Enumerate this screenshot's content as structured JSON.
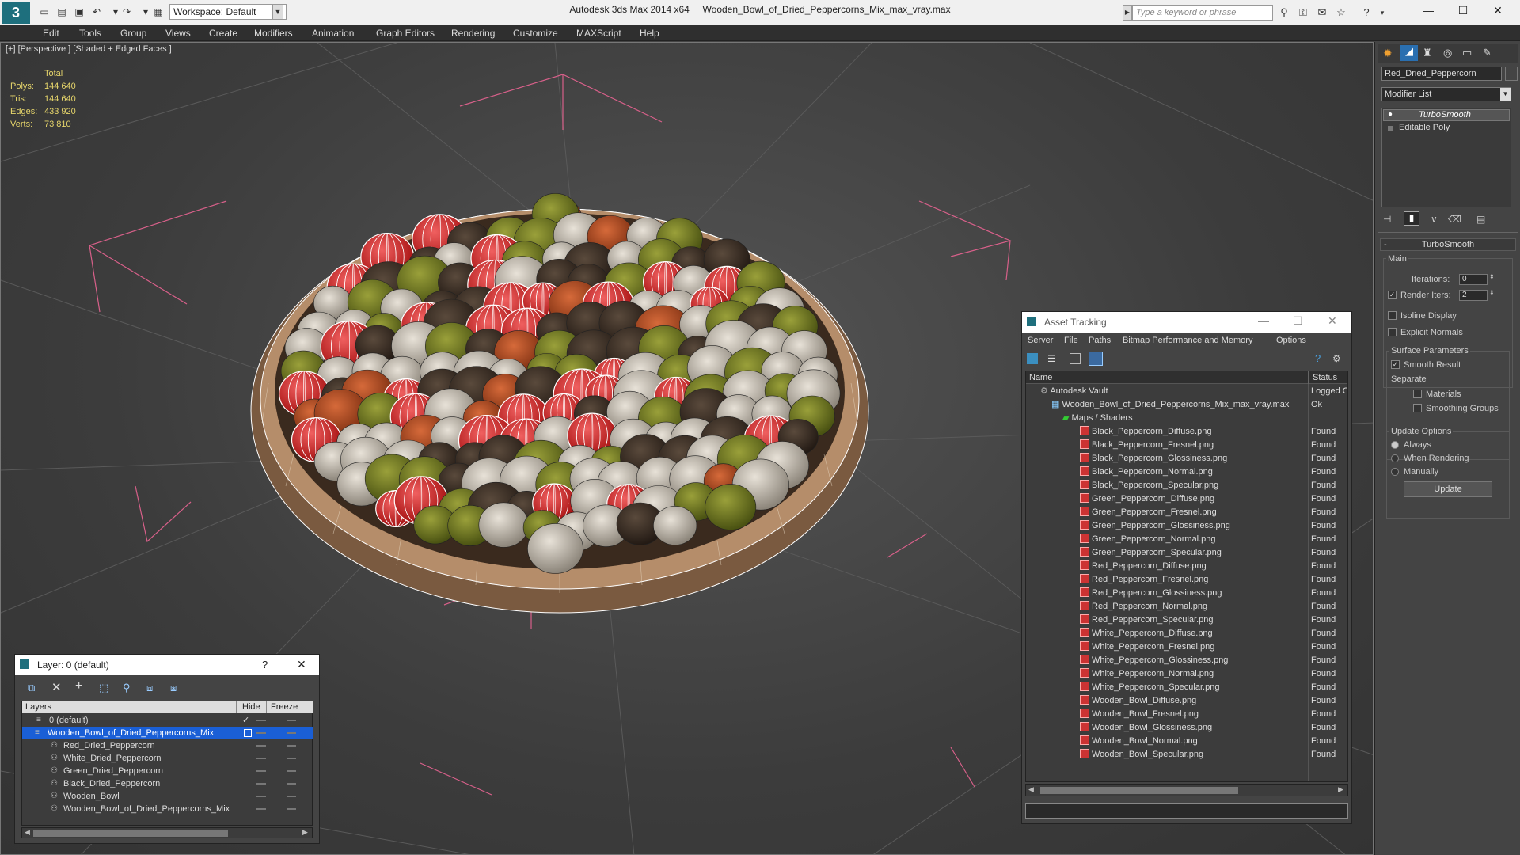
{
  "app": {
    "title": "Autodesk 3ds Max  2014 x64",
    "file": "Wooden_Bowl_of_Dried_Peppercorns_Mix_max_vray.max",
    "workspace": "Workspace: Default",
    "search_placeholder": "Type a keyword or phrase",
    "logo": "3"
  },
  "menu": [
    "Edit",
    "Tools",
    "Group",
    "Views",
    "Create",
    "Modifiers",
    "Animation",
    "Graph Editors",
    "Rendering",
    "Customize",
    "MAXScript",
    "Help"
  ],
  "viewport": {
    "label": "[+] [Perspective ] [Shaded + Edged Faces ]",
    "stats_header": "Total",
    "stats": [
      {
        "k": "Polys:",
        "v": "144 640"
      },
      {
        "k": "Tris:",
        "v": "144 640"
      },
      {
        "k": "Edges:",
        "v": "433 920"
      },
      {
        "k": "Verts:",
        "v": "73 810"
      }
    ]
  },
  "command_panel": {
    "object_name": "Red_Dried_Peppercorn",
    "modifier_list": "Modifier List",
    "stack": [
      "TurboSmooth",
      "Editable Poly"
    ],
    "rollout_title": "TurboSmooth",
    "main_label": "Main",
    "iterations_label": "Iterations:",
    "iterations_value": "0",
    "render_iters_label": "Render Iters:",
    "render_iters_value": "2",
    "isoline_label": "Isoline Display",
    "explicit_normals_label": "Explicit Normals",
    "surface_params_label": "Surface Parameters",
    "smooth_result_label": "Smooth Result",
    "separate_label": "Separate",
    "materials_label": "Materials",
    "smoothing_groups_label": "Smoothing Groups",
    "update_options_label": "Update Options",
    "always_label": "Always",
    "when_rendering_label": "When Rendering",
    "manually_label": "Manually",
    "update_button": "Update"
  },
  "asset_tracking": {
    "title": "Asset Tracking",
    "menu": [
      "Server",
      "File",
      "Paths",
      "Bitmap Performance and Memory",
      "Options"
    ],
    "col_name": "Name",
    "col_status": "Status",
    "vault": {
      "name": "Autodesk Vault",
      "status": "Logged O"
    },
    "file": {
      "name": "Wooden_Bowl_of_Dried_Peppercorns_Mix_max_vray.max",
      "status": "Ok"
    },
    "maps_folder": "Maps / Shaders",
    "assets": [
      {
        "name": "Black_Peppercorn_Diffuse.png",
        "status": "Found"
      },
      {
        "name": "Black_Peppercorn_Fresnel.png",
        "status": "Found"
      },
      {
        "name": "Black_Peppercorn_Glossiness.png",
        "status": "Found"
      },
      {
        "name": "Black_Peppercorn_Normal.png",
        "status": "Found"
      },
      {
        "name": "Black_Peppercorn_Specular.png",
        "status": "Found"
      },
      {
        "name": "Green_Peppercorn_Diffuse.png",
        "status": "Found"
      },
      {
        "name": "Green_Peppercorn_Fresnel.png",
        "status": "Found"
      },
      {
        "name": "Green_Peppercorn_Glossiness.png",
        "status": "Found"
      },
      {
        "name": "Green_Peppercorn_Normal.png",
        "status": "Found"
      },
      {
        "name": "Green_Peppercorn_Specular.png",
        "status": "Found"
      },
      {
        "name": "Red_Peppercorn_Diffuse.png",
        "status": "Found"
      },
      {
        "name": "Red_Peppercorn_Fresnel.png",
        "status": "Found"
      },
      {
        "name": "Red_Peppercorn_Glossiness.png",
        "status": "Found"
      },
      {
        "name": "Red_Peppercorn_Normal.png",
        "status": "Found"
      },
      {
        "name": "Red_Peppercorn_Specular.png",
        "status": "Found"
      },
      {
        "name": "White_Peppercorn_Diffuse.png",
        "status": "Found"
      },
      {
        "name": "White_Peppercorn_Fresnel.png",
        "status": "Found"
      },
      {
        "name": "White_Peppercorn_Glossiness.png",
        "status": "Found"
      },
      {
        "name": "White_Peppercorn_Normal.png",
        "status": "Found"
      },
      {
        "name": "White_Peppercorn_Specular.png",
        "status": "Found"
      },
      {
        "name": "Wooden_Bowl_Diffuse.png",
        "status": "Found"
      },
      {
        "name": "Wooden_Bowl_Fresnel.png",
        "status": "Found"
      },
      {
        "name": "Wooden_Bowl_Glossiness.png",
        "status": "Found"
      },
      {
        "name": "Wooden_Bowl_Normal.png",
        "status": "Found"
      },
      {
        "name": "Wooden_Bowl_Specular.png",
        "status": "Found"
      }
    ]
  },
  "layer_window": {
    "title": "Layer: 0 (default)",
    "help": "?",
    "col_layers": "Layers",
    "col_hide": "Hide",
    "col_freeze": "Freeze",
    "layers": [
      {
        "name": "0 (default)"
      },
      {
        "name": "Wooden_Bowl_of_Dried_Peppercorns_Mix"
      },
      {
        "name": "Red_Dried_Peppercorn"
      },
      {
        "name": "White_Dried_Peppercorn"
      },
      {
        "name": "Green_Dried_Peppercorn"
      },
      {
        "name": "Black_Dried_Peppercorn"
      },
      {
        "name": "Wooden_Bowl"
      },
      {
        "name": "Wooden_Bowl_of_Dried_Peppercorns_Mix"
      }
    ]
  },
  "colors": {
    "selection": "#1a5fd6",
    "stats_text": "#e6d56b",
    "wire": "#ffffff",
    "bowl": "#b58d6a"
  }
}
